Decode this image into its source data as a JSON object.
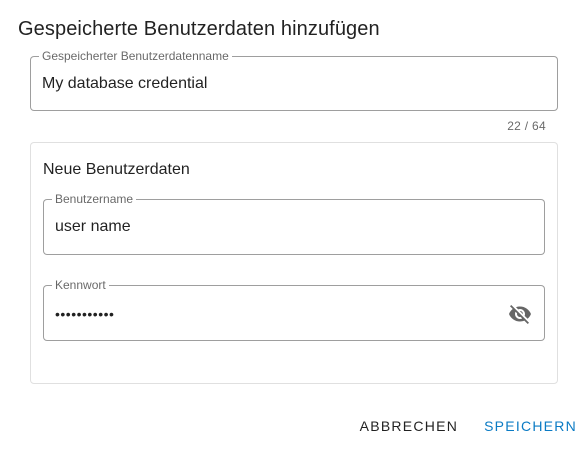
{
  "dialog": {
    "title": "Gespeicherte Benutzerdaten hinzufügen"
  },
  "credential_name": {
    "label": "Gespeicherter Benutzerdatenname",
    "value": "My database credential",
    "counter": "22 / 64"
  },
  "new_credentials": {
    "heading": "Neue Benutzerdaten",
    "username": {
      "label": "Benutzername",
      "value": "user name"
    },
    "password": {
      "label": "Kennwort",
      "value": "•••••••••••",
      "toggle_icon": "visibility-off-icon"
    }
  },
  "actions": {
    "cancel_label": "ABBRECHEN",
    "save_label": "SPEICHERN"
  },
  "colors": {
    "primary": "#0b7bc4",
    "text": "#212121",
    "border": "#9e9e9e"
  }
}
